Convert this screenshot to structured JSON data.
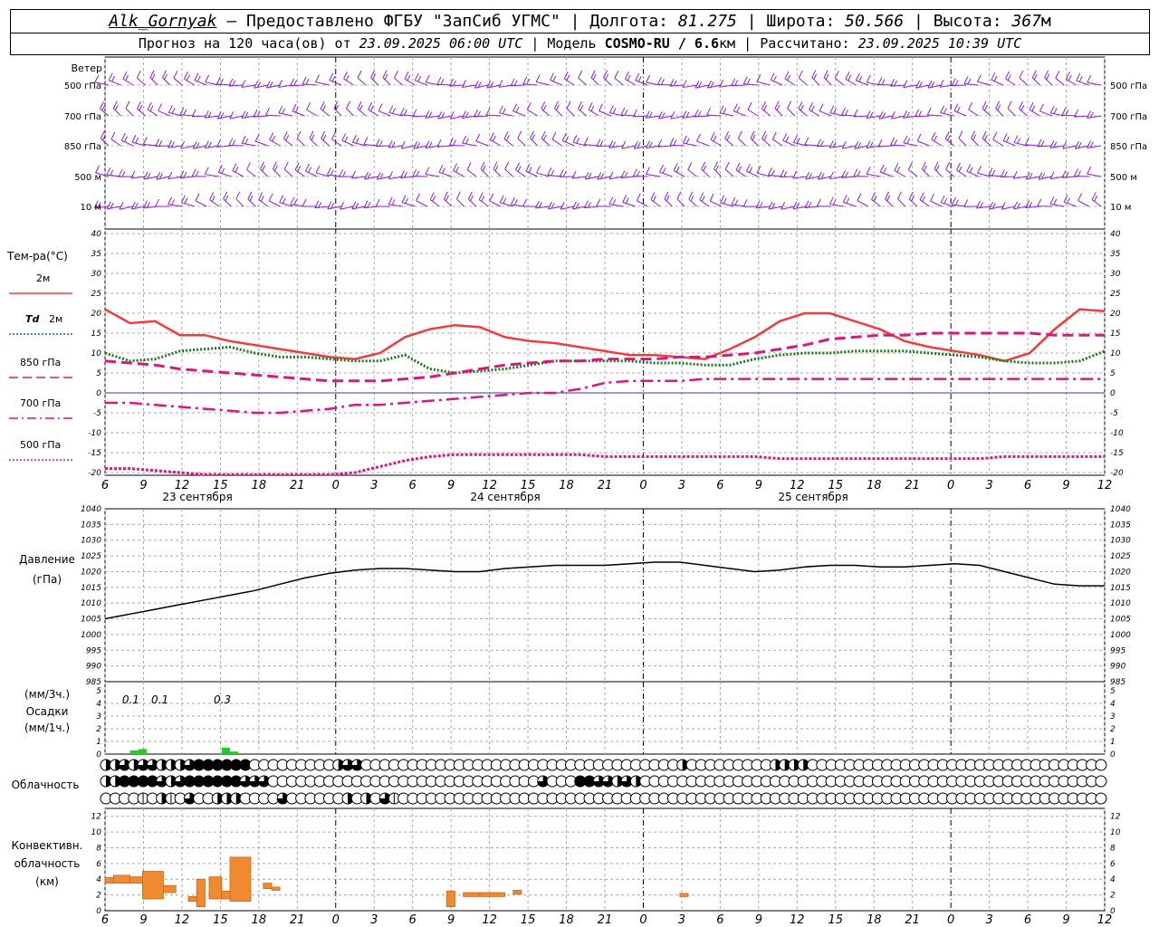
{
  "header": {
    "station": "Alk_Gornyak",
    "provider": "Предоставлено ФГБУ \"ЗапСиб УГМС\"",
    "lon_label": "Долгота:",
    "lon": "81.275",
    "lat_label": "Широта:",
    "lat": "50.566",
    "alt_label": "Высота:",
    "alt": "367",
    "alt_unit": "м",
    "forecast_label": "Прогноз на 120 часа(ов) от",
    "forecast_time": "23.09.2025 06:00 UTC",
    "model_label": "Модель",
    "model": "COSMO-RU / 6.6",
    "model_unit": "км",
    "calc_label": "Рассчитано:",
    "calc_time": "23.09.2025 10:39 UTC"
  },
  "x_axis": {
    "ticks": [
      "6",
      "9",
      "12",
      "15",
      "18",
      "21",
      "0",
      "3",
      "6",
      "9",
      "12",
      "15",
      "18",
      "21",
      "0",
      "3",
      "6",
      "9",
      "12",
      "15",
      "18",
      "21",
      "0",
      "3",
      "6",
      "9",
      "12"
    ],
    "dates": [
      "23 сентября",
      "24 сентября",
      "25 сентября"
    ]
  },
  "wind_panel": {
    "title": "Ветер",
    "levels": [
      "500 гПа",
      "700 гПа",
      "850 гПа",
      "500 м",
      "10 м"
    ],
    "color": "#8b1fd6"
  },
  "temp_panel": {
    "title": "Тем-ра(°С)",
    "ticks": [
      "40",
      "35",
      "30",
      "25",
      "20",
      "15",
      "10",
      "5",
      "0",
      "-5",
      "-10",
      "-15",
      "-20"
    ],
    "legend": [
      {
        "label": "2м",
        "color": "#f03c3c",
        "style": "solid"
      },
      {
        "label": "Td",
        "label2": "2м",
        "color": "#1a7a1a",
        "style": "dotted"
      },
      {
        "label": "850 гПа",
        "color": "#e0147e",
        "style": "dashed"
      },
      {
        "label": "700 гПа",
        "color": "#e0147e",
        "style": "dashdot"
      },
      {
        "label": "500 гПа",
        "color": "#e0147e",
        "style": "dotted"
      }
    ]
  },
  "pressure_panel": {
    "title": "Давление",
    "unit": "(гПа)",
    "ticks": [
      "1040",
      "1035",
      "1030",
      "1025",
      "1020",
      "1015",
      "1010",
      "1005",
      "1000",
      "995",
      "990",
      "985"
    ]
  },
  "precip_panel": {
    "label_top": "(мм/3ч.)",
    "title": "Осадки",
    "label_bottom": "(мм/1ч.)",
    "ticks": [
      "5",
      "4",
      "3",
      "2",
      "1",
      "0"
    ],
    "amounts": [
      "0.1",
      "0.1",
      "0.3"
    ],
    "color": "#22cc22"
  },
  "cloud_panel": {
    "title": "Облачность"
  },
  "conv_panel": {
    "title1": "Конвективн.",
    "title2": "облачность",
    "unit": "(км)",
    "ticks": [
      "12",
      "10",
      "8",
      "6",
      "4",
      "2",
      "0"
    ],
    "color": "#f08a30"
  },
  "chart_data": [
    {
      "type": "line",
      "name": "temperature",
      "x_hours": [
        0,
        3,
        6,
        9,
        12,
        15,
        18,
        21,
        24,
        27,
        30,
        33,
        36,
        39,
        42,
        45,
        48,
        51,
        54,
        57,
        60,
        63,
        66,
        69,
        72,
        75,
        78,
        81,
        84,
        87,
        90,
        93,
        96,
        99,
        102,
        105,
        108,
        111,
        114,
        117,
        120
      ],
      "series": [
        {
          "name": "2м",
          "values": [
            21,
            17.5,
            18,
            14.5,
            14.5,
            13,
            12,
            11,
            10,
            9,
            8.5,
            10,
            14,
            16,
            17,
            16.5,
            14,
            13,
            12.5,
            11.5,
            10.5,
            9.5,
            9.5,
            9,
            8.5,
            11,
            14,
            18,
            20,
            20,
            18,
            16,
            13,
            11.5,
            10.5,
            9.5,
            8,
            10,
            16,
            21,
            20.5
          ]
        },
        {
          "name": "Td 2м",
          "values": [
            10,
            8,
            8.5,
            10.5,
            11,
            11.5,
            10,
            9,
            9,
            8.5,
            8,
            8,
            9.5,
            6,
            5,
            5.5,
            6,
            7,
            8,
            8,
            8,
            8,
            7.5,
            7.5,
            7,
            7,
            8.5,
            9.5,
            10,
            10,
            10.5,
            10.5,
            10.5,
            10,
            9.5,
            9,
            8,
            7.5,
            7.5,
            8,
            10.5
          ]
        },
        {
          "name": "850 гПа",
          "values": [
            8,
            7.5,
            7,
            6,
            5.5,
            5,
            4.5,
            4,
            3.5,
            3,
            3,
            3,
            3.5,
            4,
            5,
            6,
            7,
            7.5,
            8,
            8,
            8.5,
            8.5,
            8.5,
            9,
            9,
            9.5,
            10,
            11,
            12,
            13.5,
            14,
            14.5,
            14.5,
            15,
            15,
            15,
            15,
            15,
            14.5,
            14.5,
            14.5
          ]
        },
        {
          "name": "700 гПа",
          "values": [
            -2.5,
            -2.5,
            -3,
            -3.5,
            -4,
            -4.5,
            -5,
            -5,
            -4.5,
            -4,
            -3,
            -3,
            -2.5,
            -2,
            -1.5,
            -1,
            -0.5,
            0,
            0,
            1,
            2.5,
            3,
            3,
            3,
            3.5,
            3.5,
            3.5,
            3.5,
            3.5,
            3.5,
            3.5,
            3.5,
            3.5,
            3.5,
            3.5,
            3.5,
            3.5,
            3.5,
            3.5,
            3.5,
            3.5
          ]
        },
        {
          "name": "500 гПа",
          "values": [
            -19,
            -19,
            -19.5,
            -20,
            -20.5,
            -21,
            -21.5,
            -21.5,
            -21,
            -20.5,
            -20,
            -18.5,
            -17,
            -16,
            -15.5,
            -15.5,
            -15.5,
            -15.5,
            -15.5,
            -15.5,
            -16,
            -16,
            -16,
            -16,
            -16,
            -16,
            -16,
            -16.5,
            -16.5,
            -16.5,
            -16.5,
            -16.5,
            -16.5,
            -16.5,
            -16.5,
            -16.5,
            -16,
            -16,
            -16,
            -16,
            -16
          ]
        }
      ],
      "ylim": [
        -20,
        40
      ]
    },
    {
      "type": "line",
      "name": "pressure",
      "x_hours": [
        0,
        3,
        6,
        9,
        12,
        15,
        18,
        21,
        24,
        27,
        30,
        33,
        36,
        39,
        42,
        45,
        48,
        51,
        54,
        57,
        60,
        63,
        66,
        69,
        72,
        75,
        78,
        81,
        84,
        87,
        90,
        93,
        96,
        99,
        102,
        105,
        108,
        111,
        114,
        117,
        120
      ],
      "values": [
        1005,
        1006.5,
        1008,
        1009.5,
        1011,
        1012.5,
        1014,
        1016,
        1018,
        1019.5,
        1020.5,
        1021,
        1021,
        1020.5,
        1020,
        1020,
        1021,
        1021.5,
        1022,
        1022,
        1022,
        1022.5,
        1023,
        1023,
        1022,
        1021,
        1020,
        1020.5,
        1021.5,
        1022,
        1022,
        1021.5,
        1021.5,
        1022,
        1022.5,
        1022,
        1020,
        1018,
        1016,
        1015.5,
        1015.5
      ],
      "ylim": [
        985,
        1040
      ]
    },
    {
      "type": "bar",
      "name": "precipitation",
      "x_hours": [
        3,
        4,
        14,
        15
      ],
      "values": [
        0.3,
        0.4,
        0.5,
        0.2
      ],
      "labels": [
        {
          "x_hours": 2,
          "text": "0.1"
        },
        {
          "x_hours": 5.5,
          "text": "0.1"
        },
        {
          "x_hours": 13,
          "text": "0.3"
        }
      ],
      "ylim": [
        0,
        5
      ]
    },
    {
      "type": "bar",
      "name": "convective_cloud",
      "bars": [
        {
          "x0": 0,
          "x1": 1,
          "lo": 3.5,
          "hi": 4.2
        },
        {
          "x0": 1,
          "x1": 3,
          "lo": 3.5,
          "hi": 4.5
        },
        {
          "x0": 3,
          "x1": 4.5,
          "lo": 3.5,
          "hi": 4.3
        },
        {
          "x0": 4.5,
          "x1": 7,
          "lo": 1.5,
          "hi": 5.0
        },
        {
          "x0": 7,
          "x1": 8.5,
          "lo": 2.3,
          "hi": 3.2
        },
        {
          "x0": 10,
          "x1": 11,
          "lo": 1.2,
          "hi": 1.8
        },
        {
          "x0": 11,
          "x1": 12,
          "lo": 0.5,
          "hi": 4.0
        },
        {
          "x0": 12.5,
          "x1": 14,
          "lo": 1.5,
          "hi": 4.3
        },
        {
          "x0": 14,
          "x1": 15,
          "lo": 1.5,
          "hi": 2.5
        },
        {
          "x0": 15,
          "x1": 17.5,
          "lo": 1.2,
          "hi": 6.8
        },
        {
          "x0": 19,
          "x1": 20,
          "lo": 2.8,
          "hi": 3.5
        },
        {
          "x0": 20,
          "x1": 21,
          "lo": 2.6,
          "hi": 3.0
        },
        {
          "x0": 41,
          "x1": 42,
          "lo": 0.5,
          "hi": 2.5
        },
        {
          "x0": 43,
          "x1": 45,
          "lo": 1.8,
          "hi": 2.3
        },
        {
          "x0": 45,
          "x1": 48,
          "lo": 1.8,
          "hi": 2.3
        },
        {
          "x0": 49,
          "x1": 50,
          "lo": 2.1,
          "hi": 2.6
        },
        {
          "x0": 69,
          "x1": 70,
          "lo": 1.8,
          "hi": 2.2
        }
      ],
      "ylim": [
        0,
        13
      ]
    },
    {
      "type": "heatmap",
      "name": "cloud_cover",
      "rows": [
        [
          2,
          2,
          3,
          2,
          3,
          3,
          2,
          2,
          2,
          3,
          4,
          4,
          4,
          4,
          4,
          4,
          0,
          0,
          0,
          0,
          0,
          0,
          0,
          0,
          0,
          2,
          3,
          3,
          0,
          0,
          0,
          0,
          0,
          0,
          0,
          0,
          0,
          0,
          0,
          0,
          0,
          0,
          0,
          0,
          0,
          0,
          0,
          0,
          0,
          0,
          0,
          0,
          0,
          0,
          0,
          0,
          0,
          0,
          0,
          0,
          0,
          0,
          2,
          0,
          0,
          0,
          0,
          0,
          0,
          0,
          0,
          0,
          2,
          2,
          2,
          2,
          0,
          0,
          0,
          0,
          0,
          0,
          0,
          0,
          0,
          0,
          0,
          0,
          0,
          0,
          0,
          0,
          0,
          0,
          0,
          0,
          0,
          0,
          0,
          0,
          0,
          0,
          0,
          0,
          0,
          0,
          0,
          0,
          0,
          0,
          0,
          0,
          0,
          0,
          0,
          0,
          0,
          0,
          0,
          0,
          0
        ],
        [
          2,
          2,
          4,
          4,
          4,
          4,
          3,
          2,
          3,
          4,
          4,
          4,
          4,
          4,
          4,
          3,
          3,
          3,
          0,
          0,
          0,
          0,
          0,
          0,
          0,
          0,
          0,
          0,
          0,
          0,
          0,
          0,
          0,
          0,
          0,
          0,
          0,
          0,
          0,
          0,
          0,
          0,
          0,
          0,
          0,
          0,
          0,
          3,
          0,
          0,
          0,
          4,
          4,
          3,
          3,
          2,
          3,
          2,
          0,
          0,
          0,
          0,
          0,
          0,
          0,
          0,
          0,
          0,
          0,
          0,
          0,
          0,
          0,
          0,
          0,
          0,
          0,
          0,
          0,
          0,
          0,
          0,
          0,
          0,
          0,
          0,
          0,
          0,
          0,
          0,
          0,
          0,
          0,
          0,
          0,
          0,
          0,
          0,
          0,
          0,
          0,
          0,
          0,
          0,
          0,
          0,
          0,
          0,
          0,
          0,
          0,
          0,
          0,
          0,
          0,
          0,
          0,
          0,
          0,
          0,
          0
        ],
        [
          0,
          0,
          0,
          0,
          1,
          0,
          2,
          1,
          0,
          3,
          0,
          0,
          2,
          2,
          2,
          0,
          0,
          0,
          0,
          3,
          0,
          0,
          0,
          0,
          0,
          0,
          2,
          0,
          2,
          0,
          3,
          1,
          0,
          0,
          0,
          0,
          0,
          0,
          0,
          0,
          0,
          0,
          0,
          0,
          0,
          0,
          0,
          0,
          0,
          0,
          0,
          0,
          0,
          0,
          0,
          0,
          0,
          0,
          0,
          0,
          0,
          0,
          0,
          0,
          0,
          0,
          0,
          0,
          0,
          0,
          0,
          0,
          0,
          0,
          0,
          0,
          0,
          0,
          0,
          0,
          0,
          0,
          0,
          0,
          0,
          0,
          0,
          0,
          0,
          0,
          0,
          0,
          0,
          0,
          0,
          0,
          0,
          0,
          0,
          0,
          0,
          0,
          0,
          0,
          0,
          0,
          0,
          0,
          0,
          0,
          0,
          0,
          0,
          0,
          0,
          0,
          0,
          0,
          0,
          0,
          0
        ]
      ]
    }
  ]
}
